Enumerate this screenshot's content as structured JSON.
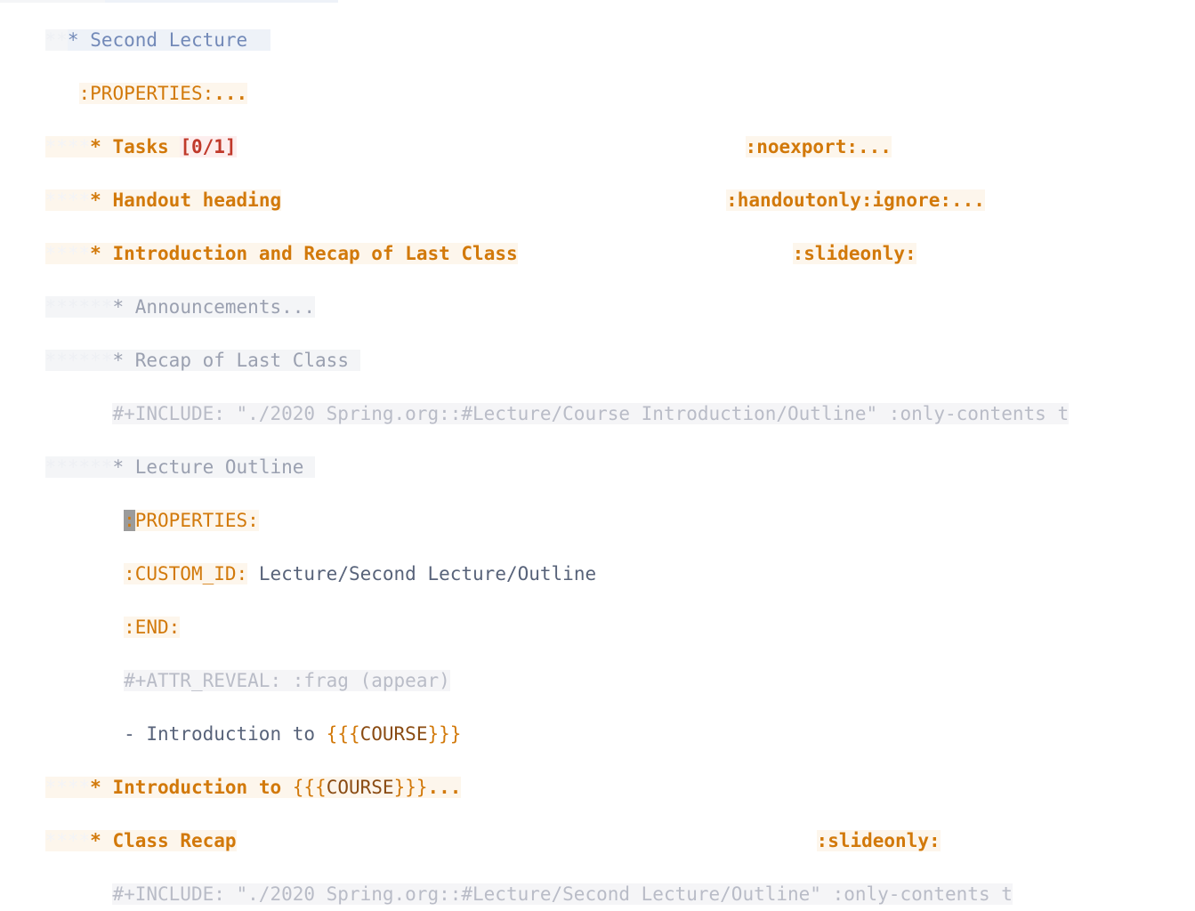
{
  "editor": {
    "app": "org-mode-outline",
    "colors": {
      "heading_orange": "#d2790a",
      "heading_blue": "#7289b8",
      "heading_faded": "#9aa0b0",
      "keyword_gray": "#b9bcc7",
      "cookie_red": "#c0392b",
      "macro_name": "#8a4b12",
      "cursor_block": "#9b9b9b",
      "bg_heading_orange": "#fdf6ec",
      "bg_heading_blue": "#eef2f8",
      "bg_heading_faded": "#f4f5f7",
      "bg_keyword": "#f5f5f7"
    },
    "cursor": {
      "line": 9,
      "column": 7,
      "char": ":"
    }
  },
  "lines": [
    {
      "id": 1,
      "kind": "heading",
      "level": 3,
      "stars_hidden": "**",
      "bullet": "*",
      "indent": "",
      "title": "Second Lecture",
      "tags": "",
      "ellipsis": ""
    },
    {
      "id": 2,
      "kind": "drawer",
      "indent": "   ",
      "text": ":PROPERTIES:",
      "ellipsis": "..."
    },
    {
      "id": 3,
      "kind": "heading",
      "level": 5,
      "stars_hidden": "****",
      "bullet": "*",
      "title": "Tasks ",
      "cookie": "[0/1]",
      "tags": ":noexport:",
      "ellipsis": "..."
    },
    {
      "id": 4,
      "kind": "heading",
      "level": 5,
      "stars_hidden": "****",
      "bullet": "*",
      "title": "Handout heading",
      "tags": ":handoutonly:ignore:",
      "ellipsis": "..."
    },
    {
      "id": 5,
      "kind": "heading",
      "level": 5,
      "stars_hidden": "****",
      "bullet": "*",
      "title": "Introduction and Recap of Last Class",
      "tags": ":slideonly:",
      "ellipsis": ""
    },
    {
      "id": 6,
      "kind": "heading-faded",
      "level": 7,
      "stars_hidden": "******",
      "bullet": "*",
      "title": "Announcements",
      "ellipsis": "..."
    },
    {
      "id": 7,
      "kind": "heading-faded",
      "level": 7,
      "stars_hidden": "******",
      "bullet": "*",
      "title": "Recap of Last Class",
      "ellipsis": ""
    },
    {
      "id": 8,
      "kind": "keyword",
      "indent": "      ",
      "text": "#+INCLUDE: \"./2020 Spring.org::#Lecture/Course Introduction/Outline\" :only-contents t"
    },
    {
      "id": 9,
      "kind": "heading-faded",
      "level": 7,
      "stars_hidden": "******",
      "bullet": "*",
      "title": "Lecture Outline",
      "ellipsis": ""
    },
    {
      "id": 10,
      "kind": "drawer-cursor",
      "indent": "       ",
      "cursor_char": ":",
      "text": "PROPERTIES:"
    },
    {
      "id": 11,
      "kind": "drawer-value",
      "indent": "       ",
      "key": ":CUSTOM_ID:",
      "value": " Lecture/Second Lecture/Outline"
    },
    {
      "id": 12,
      "kind": "drawer",
      "indent": "       ",
      "text": ":END:",
      "ellipsis": ""
    },
    {
      "id": 13,
      "kind": "keyword",
      "indent": "       ",
      "text": "#+ATTR_REVEAL: :frag (appear)"
    },
    {
      "id": 14,
      "kind": "list-item",
      "indent": "       ",
      "prefix": "- Introduction to ",
      "macro_open": "{{{",
      "macro_name": "COURSE",
      "macro_close": "}}}"
    },
    {
      "id": 15,
      "kind": "heading-macro",
      "level": 5,
      "stars_hidden": "****",
      "bullet": "*",
      "prefix": "Introduction to ",
      "macro_open": "{{{",
      "macro_name": "COURSE",
      "macro_close": "}}}",
      "ellipsis": "..."
    },
    {
      "id": 16,
      "kind": "heading",
      "level": 5,
      "stars_hidden": "****",
      "bullet": "*",
      "title": "Class Recap",
      "tags": ":slideonly:",
      "ellipsis": ""
    },
    {
      "id": 17,
      "kind": "keyword",
      "indent": "      ",
      "text": "#+INCLUDE: \"./2020 Spring.org::#Lecture/Second Lecture/Outline\" :only-contents t"
    }
  ]
}
